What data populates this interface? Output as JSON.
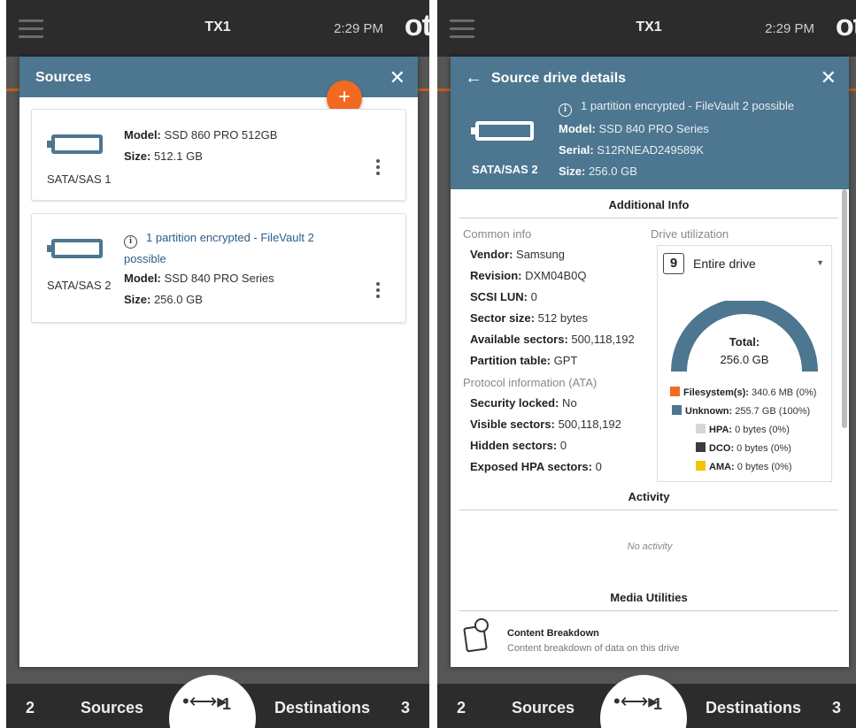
{
  "left": {
    "topbar": {
      "title": "TX1",
      "time": "2:29 PM",
      "logo": "ot"
    },
    "panel": {
      "title": "Sources",
      "close": "✕",
      "add": "+",
      "cards": [
        {
          "port": "SATA/SAS 1",
          "warning": "",
          "model_label": "Model:",
          "model": " SSD 860 PRO 512GB",
          "size_label": "Size:",
          "size": " 512.1 GB"
        },
        {
          "port": "SATA/SAS 2",
          "warning": "1 partition encrypted - FileVault 2",
          "warning2": "possible",
          "model_label": "Model:",
          "model": " SSD 840 PRO Series",
          "size_label": "Size:",
          "size": " 256.0 GB"
        }
      ]
    },
    "nav": {
      "sources_count": "2",
      "sources_label": "Sources",
      "usb_count": "1",
      "dest_label": "Destinations",
      "dest_count": "3"
    }
  },
  "right": {
    "topbar": {
      "title": "TX1",
      "time": "2:29 PM",
      "logo": "ot"
    },
    "panel": {
      "title": "Source drive details",
      "close": "✕",
      "warning": "1 partition encrypted - FileVault 2 possible",
      "model_label": "Model:",
      "model": " SSD 840 PRO Series",
      "serial_label": "Serial:",
      "serial": " S12RNEAD249589K",
      "size_label": "Size:",
      "size": " 256.0 GB",
      "port": "SATA/SAS 2",
      "additional_info": "Additional Info",
      "common_info": "Common info",
      "common": [
        {
          "k": "Vendor:",
          "v": " Samsung"
        },
        {
          "k": "Revision:",
          "v": " DXM04B0Q"
        },
        {
          "k": "SCSI LUN:",
          "v": " 0"
        },
        {
          "k": "Sector size:",
          "v": " 512 bytes"
        },
        {
          "k": "Available sectors:",
          "v": " 500,118,192"
        },
        {
          "k": "Partition table:",
          "v": " GPT"
        }
      ],
      "protocol_info": "Protocol information (ATA)",
      "protocol": [
        {
          "k": "Security locked:",
          "v": " No"
        },
        {
          "k": "Visible sectors:",
          "v": " 500,118,192"
        },
        {
          "k": "Hidden sectors:",
          "v": " 0"
        },
        {
          "k": "Exposed HPA sectors:",
          "v": " 0"
        }
      ],
      "drive_utilization": "Drive utilization",
      "select_value": "Entire drive",
      "total_label": "Total:",
      "total_value": "256.0 GB",
      "legend": [
        {
          "k": "Filesystem(s):",
          "v": " 340.6 MB (0%)",
          "color": "#f26a21"
        },
        {
          "k": "Unknown:",
          "v": " 255.7 GB (100%)",
          "color": "#4d7690"
        },
        {
          "k": "HPA:",
          "v": " 0 bytes (0%)",
          "color": "#d6d6d6"
        },
        {
          "k": "DCO:",
          "v": " 0 bytes (0%)",
          "color": "#3c3c3c"
        },
        {
          "k": "AMA:",
          "v": " 0 bytes (0%)",
          "color": "#f5c400"
        }
      ],
      "activity": "Activity",
      "no_activity": "No activity",
      "media_utilities": "Media Utilities",
      "content_title": "Content Breakdown",
      "content_desc": "Content breakdown of data on this drive"
    },
    "nav": {
      "sources_count": "2",
      "sources_label": "Sources",
      "usb_count": "1",
      "dest_label": "Destinations",
      "dest_count": "3"
    }
  },
  "colors": {
    "header": "#4d7690",
    "accent": "#f26a21",
    "topbar": "#2c2c2c",
    "link": "#2d5c88"
  }
}
